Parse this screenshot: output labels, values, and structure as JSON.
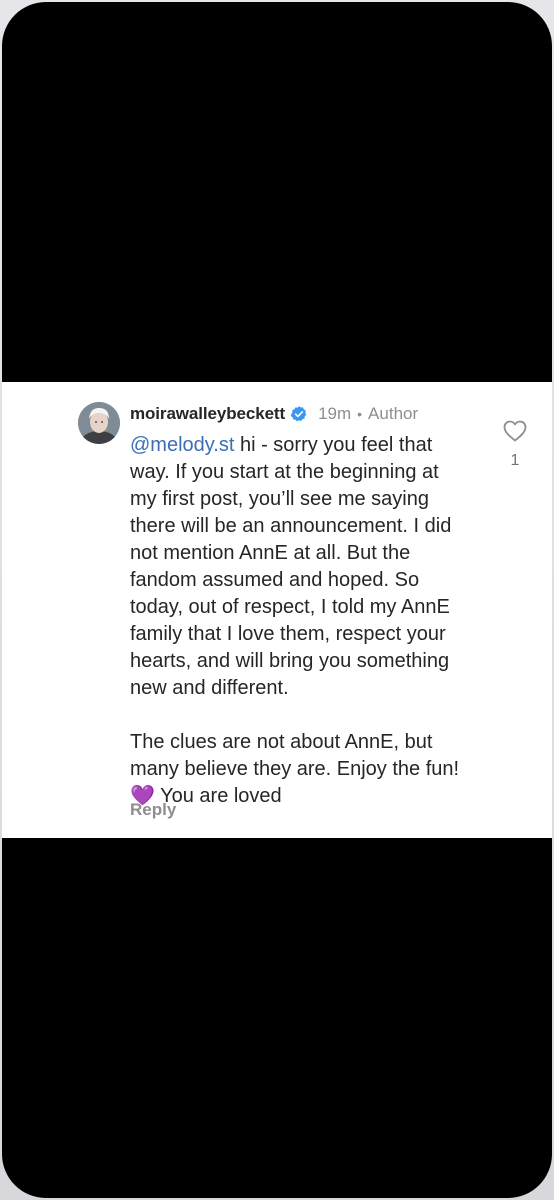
{
  "comment": {
    "username": "moirawalleybeckett",
    "timestamp": "19m",
    "separator": "•",
    "role_label": "Author",
    "mention": "@melody.st",
    "lines": [
      " hi - sorry you feel that",
      "way. If you start at the beginning at",
      "my first post, you’ll see me saying",
      "there will be an announcement. I did",
      "not mention AnnE at all. But the",
      "fandom assumed and hoped. So",
      "today, out of respect, I told my AnnE",
      "family that I love them, respect your",
      "hearts, and will bring you something",
      "new and different."
    ],
    "paragraph2": [
      "The clues are not about AnnE, but",
      "many believe they are. Enjoy the fun!",
      "💜 You are loved"
    ],
    "reply_label": "Reply",
    "like_count": "1",
    "icons": {
      "verified": "verified-badge-icon",
      "like": "heart-outline-icon"
    }
  },
  "colors": {
    "mention": "#3a6fb8",
    "verified": "#3897f0",
    "secondary_text": "#8e8e8e",
    "primary_text": "#262626"
  }
}
